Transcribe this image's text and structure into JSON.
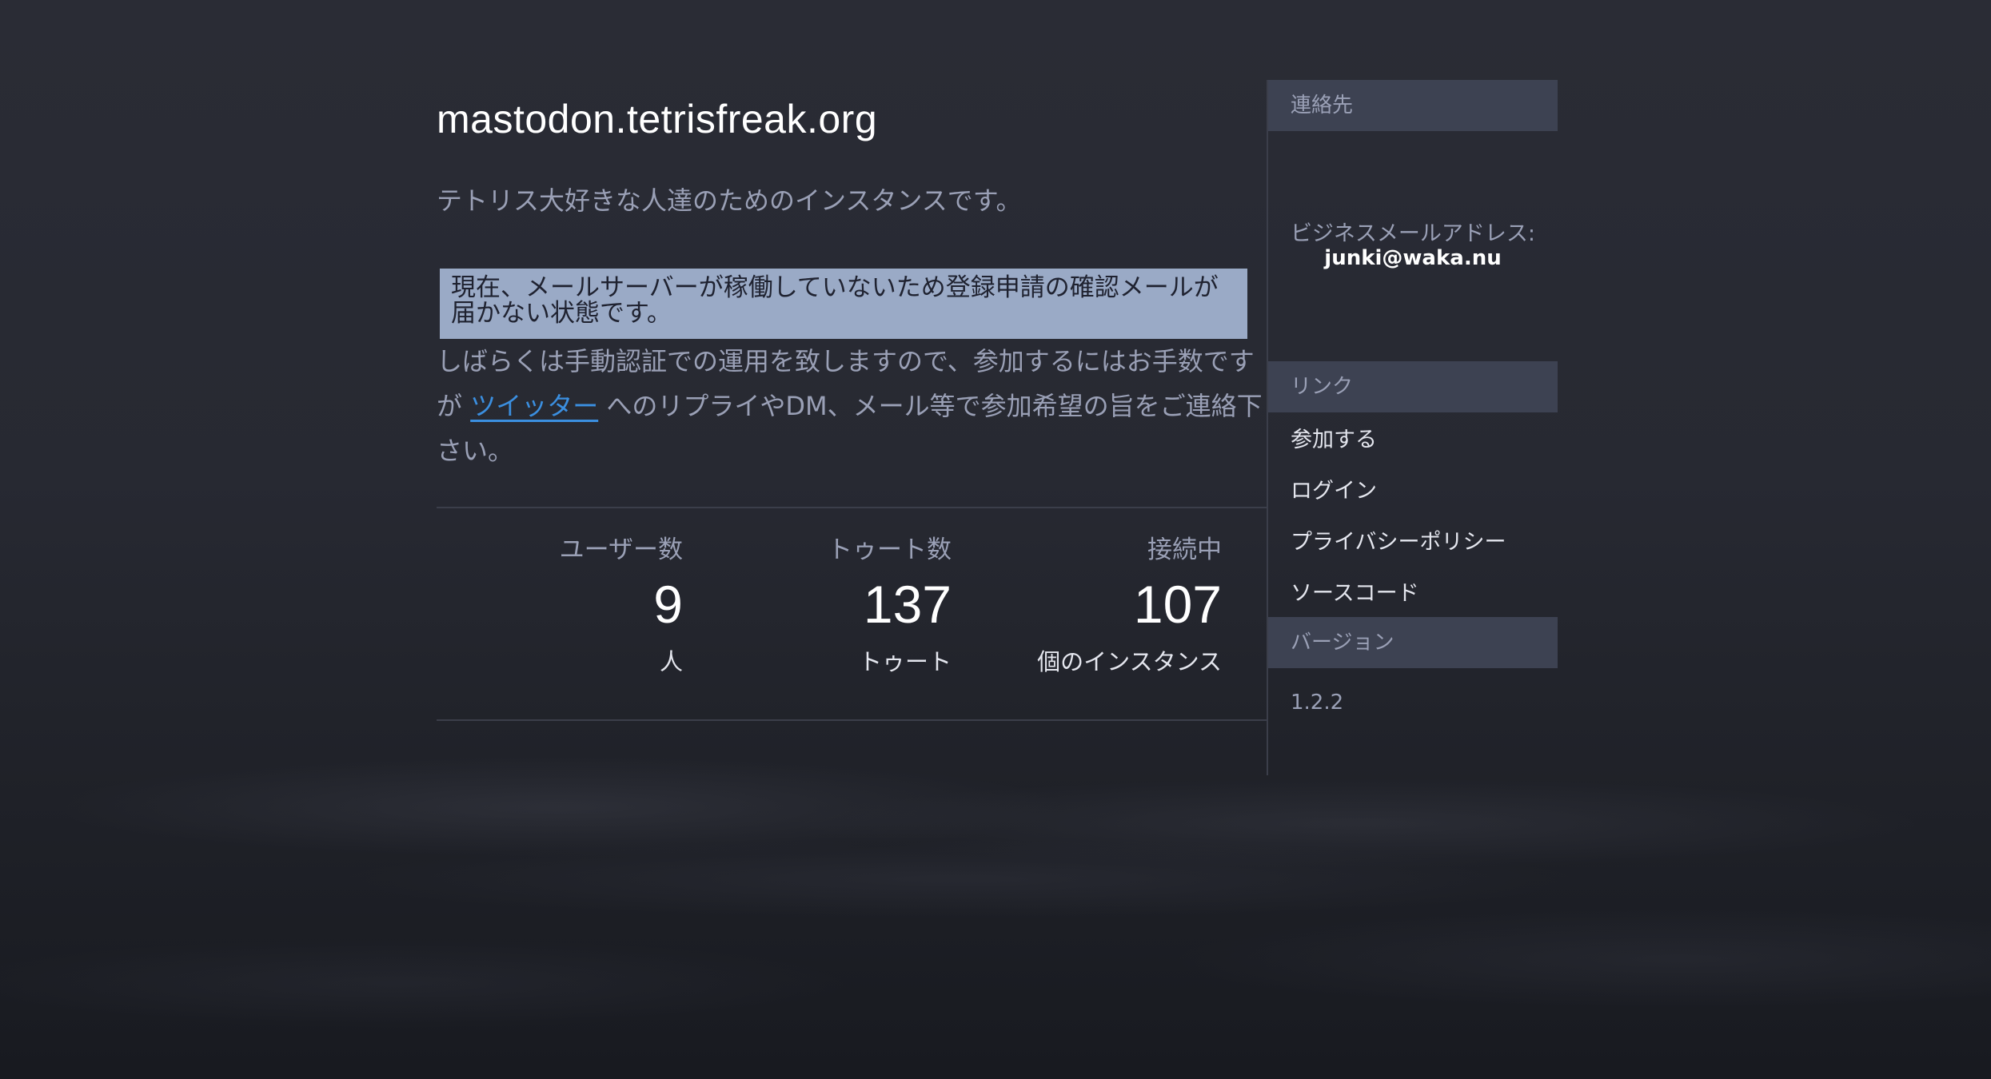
{
  "site": {
    "title": "mastodon.tetrisfreak.org",
    "description": "テトリス大好きな人達のためのインスタンスです。"
  },
  "notice": {
    "highlight": "現在、メールサーバーが稼働していないため登録申請の確認メールが届かない状態です。",
    "text_before": "しばらくは手動認証での運用を致しますので、参加するにはお手数ですが ",
    "link_text": "ツイッター",
    "text_after": " へのリプライやDM、メール等で参加希望の旨をご連絡下さい。"
  },
  "stats": [
    {
      "label": "ユーザー数",
      "value": "9",
      "unit": "人"
    },
    {
      "label": "トゥート数",
      "value": "137",
      "unit": "トゥート"
    },
    {
      "label": "接続中",
      "value": "107",
      "unit": "個のインスタンス"
    }
  ],
  "sidebar": {
    "contact_header": "連絡先",
    "contact_label": "ビジネスメールアドレス:",
    "contact_email": "junki@waka.nu",
    "links_header": "リンク",
    "links": [
      "参加する",
      "ログイン",
      "プライバシーポリシー",
      "ソースコード"
    ],
    "version_header": "バージョン",
    "version": "1.2.2"
  },
  "colors": {
    "background": "#23252d",
    "sidebar_header": "#3d4252",
    "notice_highlight": "#9aaac6",
    "link": "#3b8fe0",
    "muted_text": "#9aa0b6"
  }
}
